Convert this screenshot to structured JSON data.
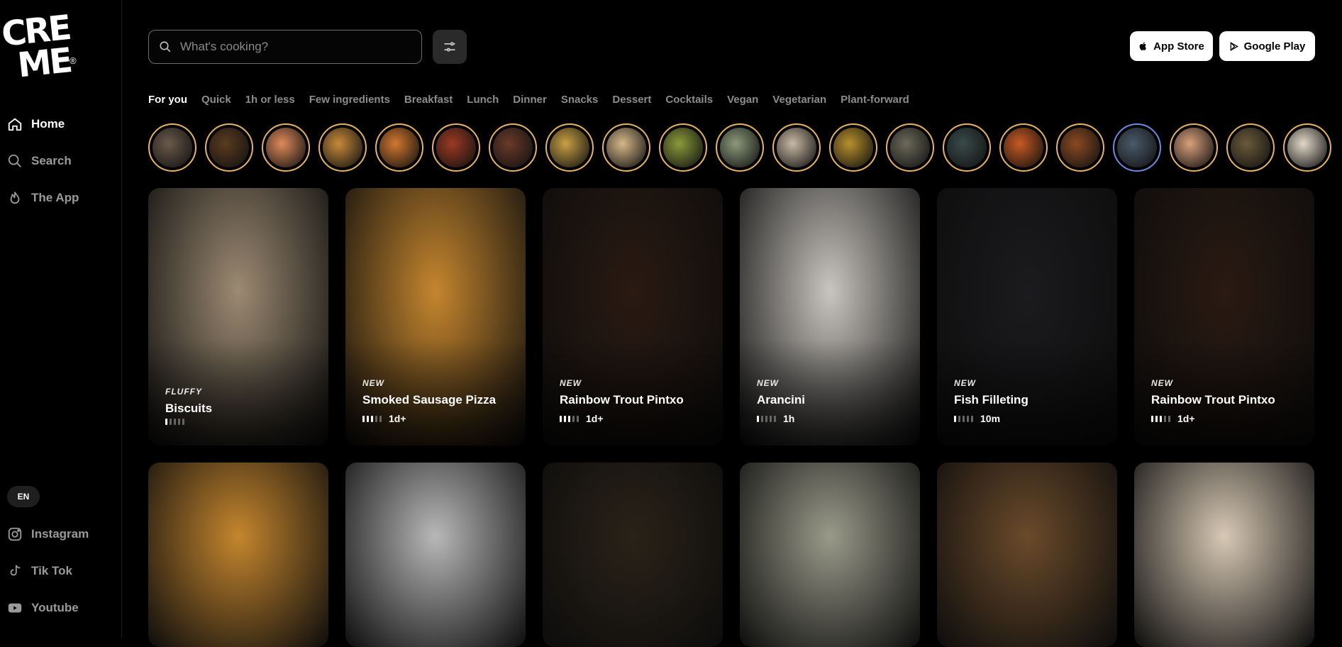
{
  "logo": {
    "text_line1": "CRE",
    "text_line2": "ME",
    "reg": "®"
  },
  "sidebar": {
    "nav": [
      {
        "label": "Home",
        "icon": "home-icon",
        "active": true
      },
      {
        "label": "Search",
        "icon": "search-icon",
        "active": false
      },
      {
        "label": "The App",
        "icon": "flame-icon",
        "active": false
      }
    ],
    "language": "EN",
    "social": [
      {
        "label": "Instagram",
        "icon": "instagram-icon"
      },
      {
        "label": "Tik Tok",
        "icon": "tiktok-icon"
      },
      {
        "label": "Youtube",
        "icon": "youtube-icon"
      }
    ]
  },
  "search": {
    "placeholder": "What's cooking?"
  },
  "stores": {
    "app_store": "App Store",
    "google_play": "Google Play"
  },
  "tabs": [
    {
      "label": "For you",
      "active": true
    },
    {
      "label": "Quick"
    },
    {
      "label": "1h or less"
    },
    {
      "label": "Few ingredients"
    },
    {
      "label": "Breakfast"
    },
    {
      "label": "Lunch"
    },
    {
      "label": "Dinner"
    },
    {
      "label": "Snacks"
    },
    {
      "label": "Dessert"
    },
    {
      "label": "Cocktails"
    },
    {
      "label": "Vegan"
    },
    {
      "label": "Vegetarian"
    },
    {
      "label": "Plant-forward"
    }
  ],
  "stories": [
    {
      "ring": "#e7b35f",
      "color": "#6b5a4a"
    },
    {
      "ring": "#e7b35f",
      "color": "#5a3b1f"
    },
    {
      "ring": "#e7b35f",
      "color": "#e08a5a"
    },
    {
      "ring": "#e7b35f",
      "color": "#c88a3a"
    },
    {
      "ring": "#e7b35f",
      "color": "#d2782e"
    },
    {
      "ring": "#e7b35f",
      "color": "#9b3a22"
    },
    {
      "ring": "#e7b35f",
      "color": "#6a3a2a"
    },
    {
      "ring": "#e7b35f",
      "color": "#c9a044"
    },
    {
      "ring": "#e7b35f",
      "color": "#d7b889"
    },
    {
      "ring": "#e7b35f",
      "color": "#8a9a3a"
    },
    {
      "ring": "#e7b35f",
      "color": "#8c9a7a"
    },
    {
      "ring": "#e7b35f",
      "color": "#c9b9a4"
    },
    {
      "ring": "#e7b35f",
      "color": "#b8902c"
    },
    {
      "ring": "#e7b35f",
      "color": "#6c6a5a"
    },
    {
      "ring": "#e7b35f",
      "color": "#3a4a4a"
    },
    {
      "ring": "#e7b35f",
      "color": "#c85a22"
    },
    {
      "ring": "#e7b35f",
      "color": "#8a4a22"
    },
    {
      "ring": "#6a8ce0",
      "color": "#4a5a6a"
    },
    {
      "ring": "#e7b35f",
      "color": "#d9a07a"
    },
    {
      "ring": "#e7b35f",
      "color": "#6a5a3a"
    },
    {
      "ring": "#e7b35f",
      "color": "#e3d9c9"
    }
  ],
  "cards": [
    {
      "tagline": "FLUFFY",
      "title": "Biscuits",
      "difficulty": 1,
      "time": "",
      "bg": "#9c8a72"
    },
    {
      "tagline": "NEW",
      "title": "Smoked Sausage Pizza",
      "difficulty": 3,
      "time": "1d+",
      "bg": "#c5862e"
    },
    {
      "tagline": "NEW",
      "title": "Rainbow Trout Pintxo",
      "difficulty": 3,
      "time": "1d+",
      "bg": "#2a1a12"
    },
    {
      "tagline": "NEW",
      "title": "Arancini",
      "difficulty": 1,
      "time": "1h",
      "bg": "#c9c5bf"
    },
    {
      "tagline": "NEW",
      "title": "Fish Filleting",
      "difficulty": 1,
      "time": "10m",
      "bg": "#1b1b1e"
    },
    {
      "tagline": "NEW",
      "title": "Rainbow Trout Pintxo",
      "difficulty": 3,
      "time": "1d+",
      "bg": "#2a1a12"
    },
    {
      "bg": "#c5862e"
    },
    {
      "bg": "#b8b8b8"
    },
    {
      "bg": "#2a2218"
    },
    {
      "bg": "#9a9a8a"
    },
    {
      "bg": "#6a4a2a"
    },
    {
      "bg": "#d7c8b4"
    }
  ]
}
